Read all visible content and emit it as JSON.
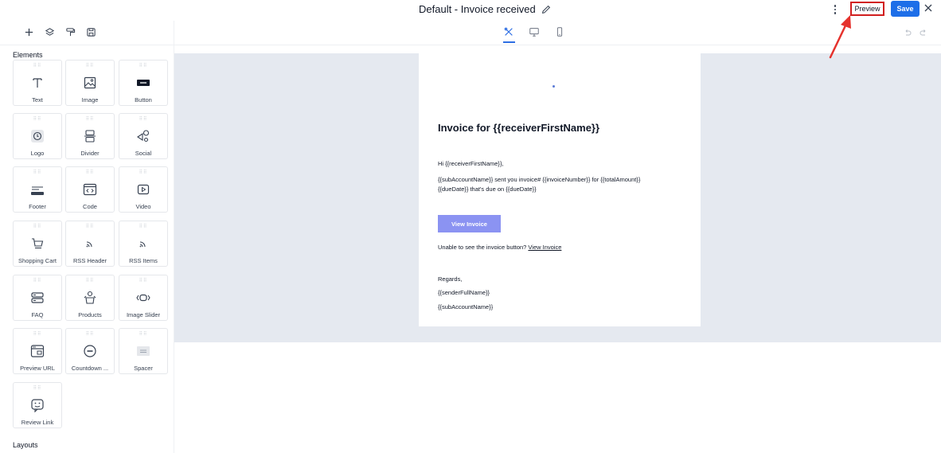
{
  "header": {
    "title": "Default - Invoice received",
    "preview_label": "Preview",
    "save_label": "Save"
  },
  "colors": {
    "accent": "#1d6ee8",
    "annotation": "#d11f1f",
    "canvas_bg": "#e5e9f0",
    "email_button": "#8b93f2"
  },
  "sidebar": {
    "elements_label": "Elements",
    "layouts_label": "Layouts",
    "elements": [
      {
        "label": "Text",
        "icon": "text-icon"
      },
      {
        "label": "Image",
        "icon": "image-icon"
      },
      {
        "label": "Button",
        "icon": "button-icon"
      },
      {
        "label": "Logo",
        "icon": "logo-icon"
      },
      {
        "label": "Divider",
        "icon": "divider-icon"
      },
      {
        "label": "Social",
        "icon": "social-icon"
      },
      {
        "label": "Footer",
        "icon": "footer-icon"
      },
      {
        "label": "Code",
        "icon": "code-icon"
      },
      {
        "label": "Video",
        "icon": "video-icon"
      },
      {
        "label": "Shopping Cart",
        "icon": "cart-icon"
      },
      {
        "label": "RSS Header",
        "icon": "rss-icon"
      },
      {
        "label": "RSS Items",
        "icon": "rss-icon"
      },
      {
        "label": "FAQ",
        "icon": "faq-icon"
      },
      {
        "label": "Products",
        "icon": "products-icon"
      },
      {
        "label": "Image Slider",
        "icon": "slider-icon"
      },
      {
        "label": "Preview URL",
        "icon": "preview-url-icon"
      },
      {
        "label": "Countdown ...",
        "icon": "countdown-icon"
      },
      {
        "label": "Spacer",
        "icon": "spacer-icon"
      },
      {
        "label": "Review Link",
        "icon": "review-icon"
      }
    ]
  },
  "email": {
    "heading": "Invoice for {{receiverFirstName}}",
    "greeting": "Hi {{receiverFirstName}},",
    "line1": "{{subAccountName}} sent you invoice# {{invoiceNumber}} for {{totalAmount}}",
    "line2": "{{dueDate}} that's due on {{dueDate}}",
    "button_label": "View Invoice",
    "unable_text": "Unable to see the invoice button? ",
    "unable_link": "View Invoice",
    "regards": "Regards,",
    "sender": "{{senderFullName}}",
    "account": "{{subAccountName}}"
  }
}
